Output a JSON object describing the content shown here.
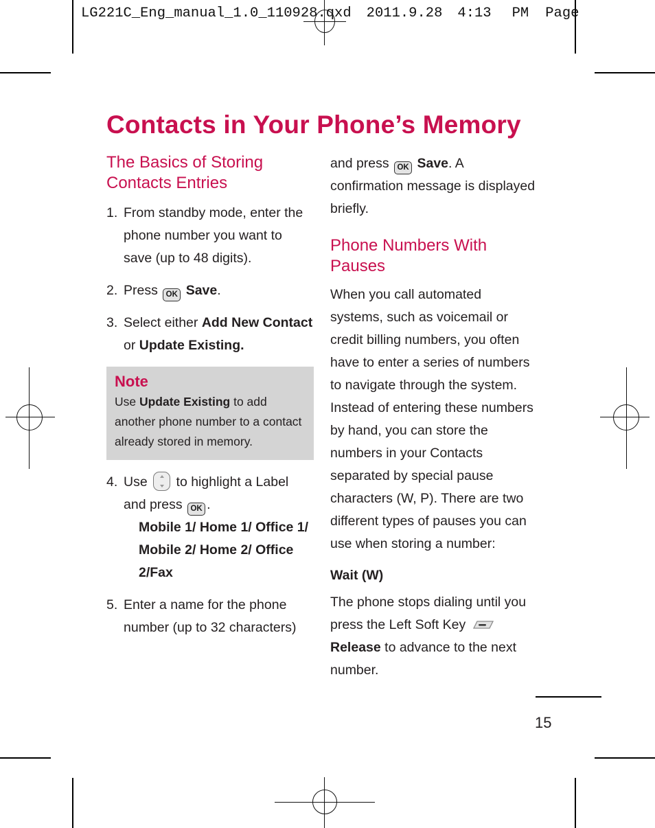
{
  "file_header": {
    "filename": "LG221C_Eng_manual_1.0_110928.qxd",
    "date": "2011.9.28",
    "time": "4:13",
    "meridiem": "PM",
    "page_label": "Page"
  },
  "page": {
    "title": "Contacts in Your Phone’s Memory",
    "page_number": "15",
    "accent_color": "#c8104f",
    "note_bg_color": "#d4d4d4",
    "text_color": "#231f20"
  },
  "left_column": {
    "heading": "The Basics of Storing Contacts Entries",
    "steps": [
      {
        "num": "1.",
        "text": "From standby mode, enter the phone number you want to save (up to 48 digits)."
      },
      {
        "num": "2.",
        "pre": "Press",
        "icon": "ok-key-icon",
        "bold": "Save",
        "post": "."
      },
      {
        "num": "3.",
        "pre": "Select either ",
        "bold1": "Add New Contact",
        "mid": " or ",
        "bold2": "Update Existing."
      },
      {
        "num": "4.",
        "pre": "Use",
        "icon_nav": "nav-key-icon",
        "mid": "to highlight a Label and press",
        "icon_ok": "ok-key-icon",
        "post": ".",
        "labels": "Mobile 1/ Home 1/ Office 1/ Mobile 2/ Home 2/ Office 2/Fax"
      },
      {
        "num": "5.",
        "text": "Enter a name for the phone number (up to 32 characters)"
      }
    ],
    "note": {
      "title": "Note",
      "pre": "Use ",
      "bold": "Update Existing",
      "post": " to add another phone number to a contact already stored in memory."
    }
  },
  "right_column": {
    "continuation": {
      "pre": "and press",
      "icon": "ok-key-icon",
      "bold": "Save",
      "post": ". A confirmation message is displayed briefly."
    },
    "heading": "Phone Numbers With Pauses",
    "paragraph": "When you call automated systems, such as voicemail or credit billing numbers, you often have to enter a series of numbers to navigate through the system. Instead of entering these numbers by hand, you can store the numbers in your Contacts separated by special pause characters (W, P). There are two different types of pauses you can use when storing a number:",
    "subheading": "Wait (W)",
    "wait_text": {
      "pre": "The phone stops dialing until you press the Left Soft Key",
      "icon": "left-soft-key-icon",
      "bold": "Release",
      "post": " to advance to the next number."
    }
  }
}
